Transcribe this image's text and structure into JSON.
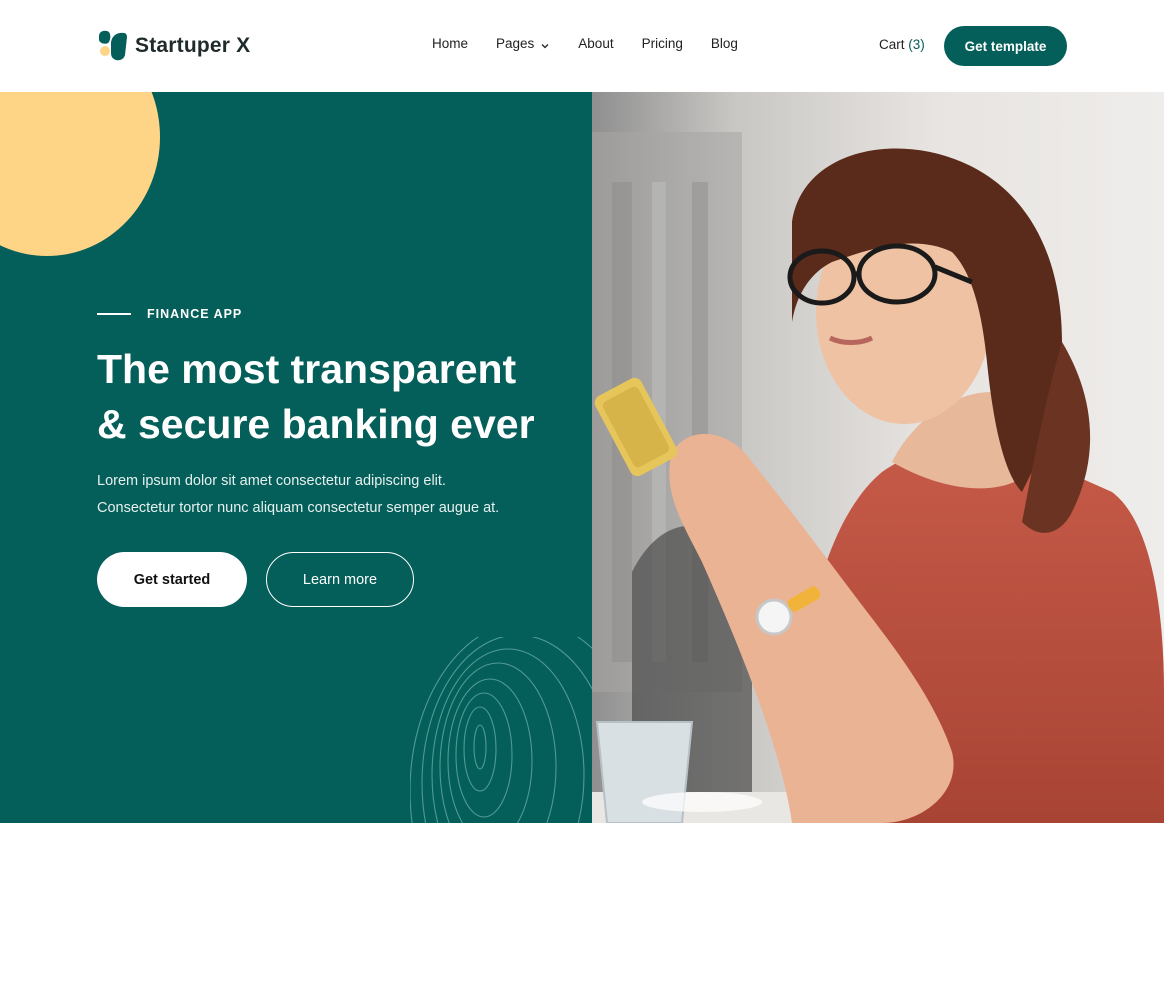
{
  "brand": {
    "name": "Startuper X",
    "accent": "#045e59",
    "secondary": "#fed586"
  },
  "nav": {
    "items": [
      {
        "label": "Home"
      },
      {
        "label": "Pages",
        "has_dropdown": true
      },
      {
        "label": "About"
      },
      {
        "label": "Pricing"
      },
      {
        "label": "Blog"
      }
    ]
  },
  "header": {
    "cart_label": "Cart",
    "cart_count": "(3)",
    "cta_label": "Get template"
  },
  "hero": {
    "eyebrow": "FINANCE APP",
    "title_line1": "The most transparent",
    "title_line2": "& secure banking ever",
    "subtext_line1": "Lorem ipsum dolor sit amet consectetur adipiscing elit.",
    "subtext_line2": "Consectetur tortor nunc aliquam consectetur semper augue at.",
    "primary_button": "Get started",
    "secondary_button": "Learn more"
  },
  "icons": {
    "logo": "startuper-logo-icon",
    "dropdown": "chevron-down-icon"
  }
}
